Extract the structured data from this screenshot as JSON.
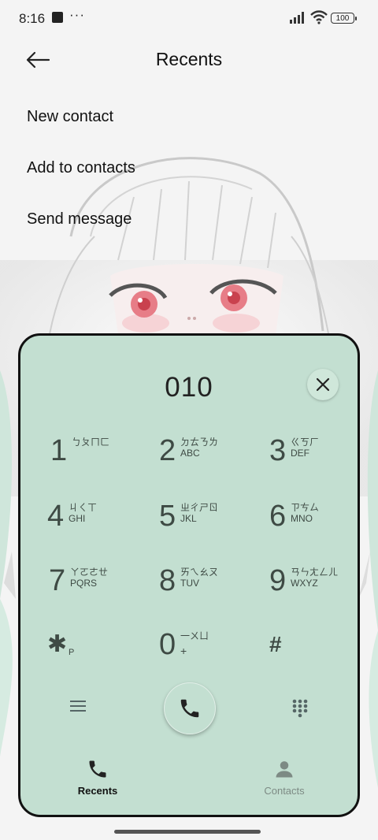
{
  "status_bar": {
    "time": "8:16",
    "overflow": "···",
    "battery": "100",
    "icons": [
      "notification-square-icon",
      "signal-icon",
      "wifi-icon",
      "battery-icon"
    ]
  },
  "header": {
    "title": "Recents",
    "back_icon": "back-arrow-icon"
  },
  "menu": {
    "items": [
      "New contact",
      "Add to contacts",
      "Send message"
    ]
  },
  "dialer": {
    "number": "010",
    "clear_icon": "close-icon",
    "keys": [
      {
        "digit": "1",
        "zhuyin": "ㄅㄆㄇㄈ",
        "letters": ""
      },
      {
        "digit": "2",
        "zhuyin": "ㄉㄊㄋㄌ",
        "letters": "ABC"
      },
      {
        "digit": "3",
        "zhuyin": "ㄍㄎㄏ",
        "letters": "DEF"
      },
      {
        "digit": "4",
        "zhuyin": "ㄐㄑㄒ",
        "letters": "GHI"
      },
      {
        "digit": "5",
        "zhuyin": "ㄓㄔㄕㄖ",
        "letters": "JKL"
      },
      {
        "digit": "6",
        "zhuyin": "ㄗㄘㄙ",
        "letters": "MNO"
      },
      {
        "digit": "7",
        "zhuyin": "ㄚㄛㄜㄝ",
        "letters": "PQRS"
      },
      {
        "digit": "8",
        "zhuyin": "ㄞㄟㄠㄡ",
        "letters": "TUV"
      },
      {
        "digit": "9",
        "zhuyin": "ㄢㄣㄤㄥㄦ",
        "letters": "WXYZ"
      }
    ],
    "star": {
      "symbol": "✱",
      "sub": "P"
    },
    "zero": {
      "digit": "0",
      "zhuyin": "一ㄨㄩ",
      "sub": "+"
    },
    "hash": {
      "symbol": "#"
    },
    "bottom_icons": [
      "menu-lines-icon",
      "phone-icon",
      "dialpad-dots-icon"
    ]
  },
  "bottom_nav": {
    "tabs": [
      {
        "label": "Recents",
        "icon": "phone-icon",
        "active": true
      },
      {
        "label": "Contacts",
        "icon": "person-icon",
        "active": false
      }
    ]
  },
  "colors": {
    "dialer_bg": "#c3dfd1",
    "text_dark": "#111111",
    "key_text": "#3e4a44",
    "inactive_tab": "#7d8a84"
  }
}
